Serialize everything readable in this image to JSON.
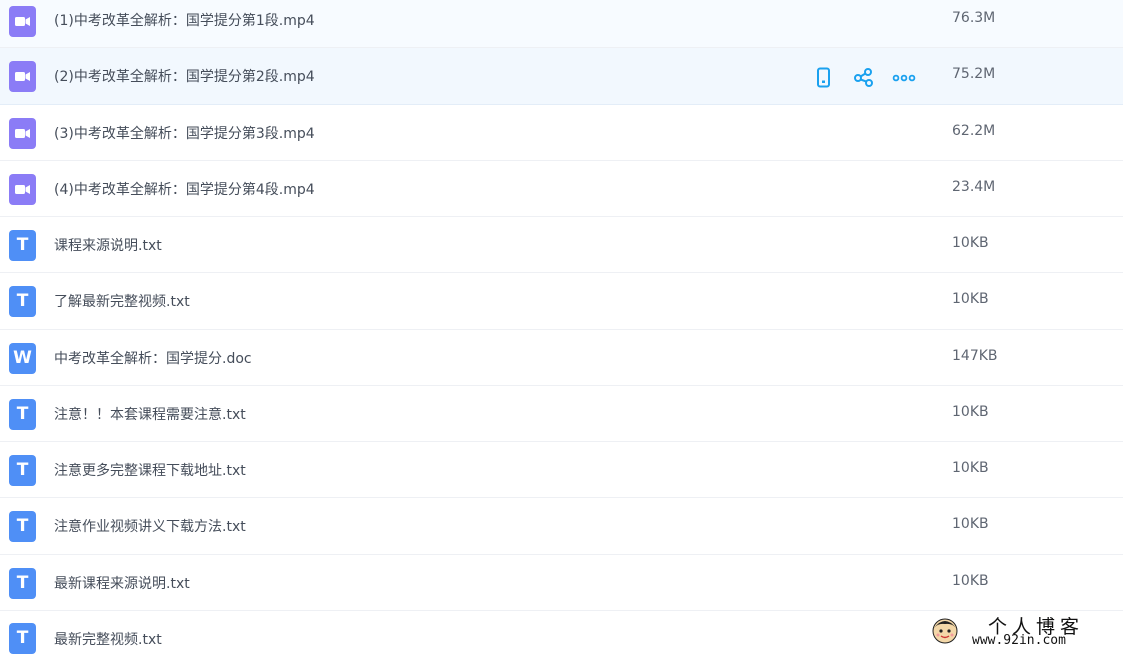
{
  "files": [
    {
      "type": "video",
      "name": "(1)中考改革全解析：国学提分第1段.mp4",
      "size": "76.3M",
      "icon": "video-file-icon"
    },
    {
      "type": "video",
      "name": "(2)中考改革全解析：国学提分第2段.mp4",
      "size": "75.2M",
      "icon": "video-file-icon"
    },
    {
      "type": "video",
      "name": "(3)中考改革全解析：国学提分第3段.mp4",
      "size": "62.2M",
      "icon": "video-file-icon"
    },
    {
      "type": "video",
      "name": "(4)中考改革全解析：国学提分第4段.mp4",
      "size": "23.4M",
      "icon": "video-file-icon"
    },
    {
      "type": "txt",
      "name": "课程来源说明.txt",
      "size": "10KB",
      "icon": "text-file-icon",
      "glyph": "T"
    },
    {
      "type": "txt",
      "name": "了解最新完整视频.txt",
      "size": "10KB",
      "icon": "text-file-icon",
      "glyph": "T"
    },
    {
      "type": "doc",
      "name": "中考改革全解析：国学提分.doc",
      "size": "147KB",
      "icon": "word-file-icon",
      "glyph": "W"
    },
    {
      "type": "txt",
      "name": "注意！！本套课程需要注意.txt",
      "size": "10KB",
      "icon": "text-file-icon",
      "glyph": "T"
    },
    {
      "type": "txt",
      "name": "注意更多完整课程下载地址.txt",
      "size": "10KB",
      "icon": "text-file-icon",
      "glyph": "T"
    },
    {
      "type": "txt",
      "name": "注意作业视频讲义下载方法.txt",
      "size": "10KB",
      "icon": "text-file-icon",
      "glyph": "T"
    },
    {
      "type": "txt",
      "name": "最新课程来源说明.txt",
      "size": "10KB",
      "icon": "text-file-icon",
      "glyph": "T"
    },
    {
      "type": "txt",
      "name": "最新完整视频.txt",
      "size": "",
      "icon": "text-file-icon",
      "glyph": "T"
    }
  ],
  "row_actions": {
    "icons": [
      "mobile-icon",
      "share-icon",
      "more-icon"
    ],
    "color": "#1aa1ef"
  },
  "colors": {
    "video_icon": "#8b7cf6",
    "doc_icon": "#4f8ff6",
    "hover_row": "#f2f8fe",
    "text": "#454d5a"
  },
  "watermark": {
    "title": "个人博客",
    "url": "www.92in.com"
  }
}
